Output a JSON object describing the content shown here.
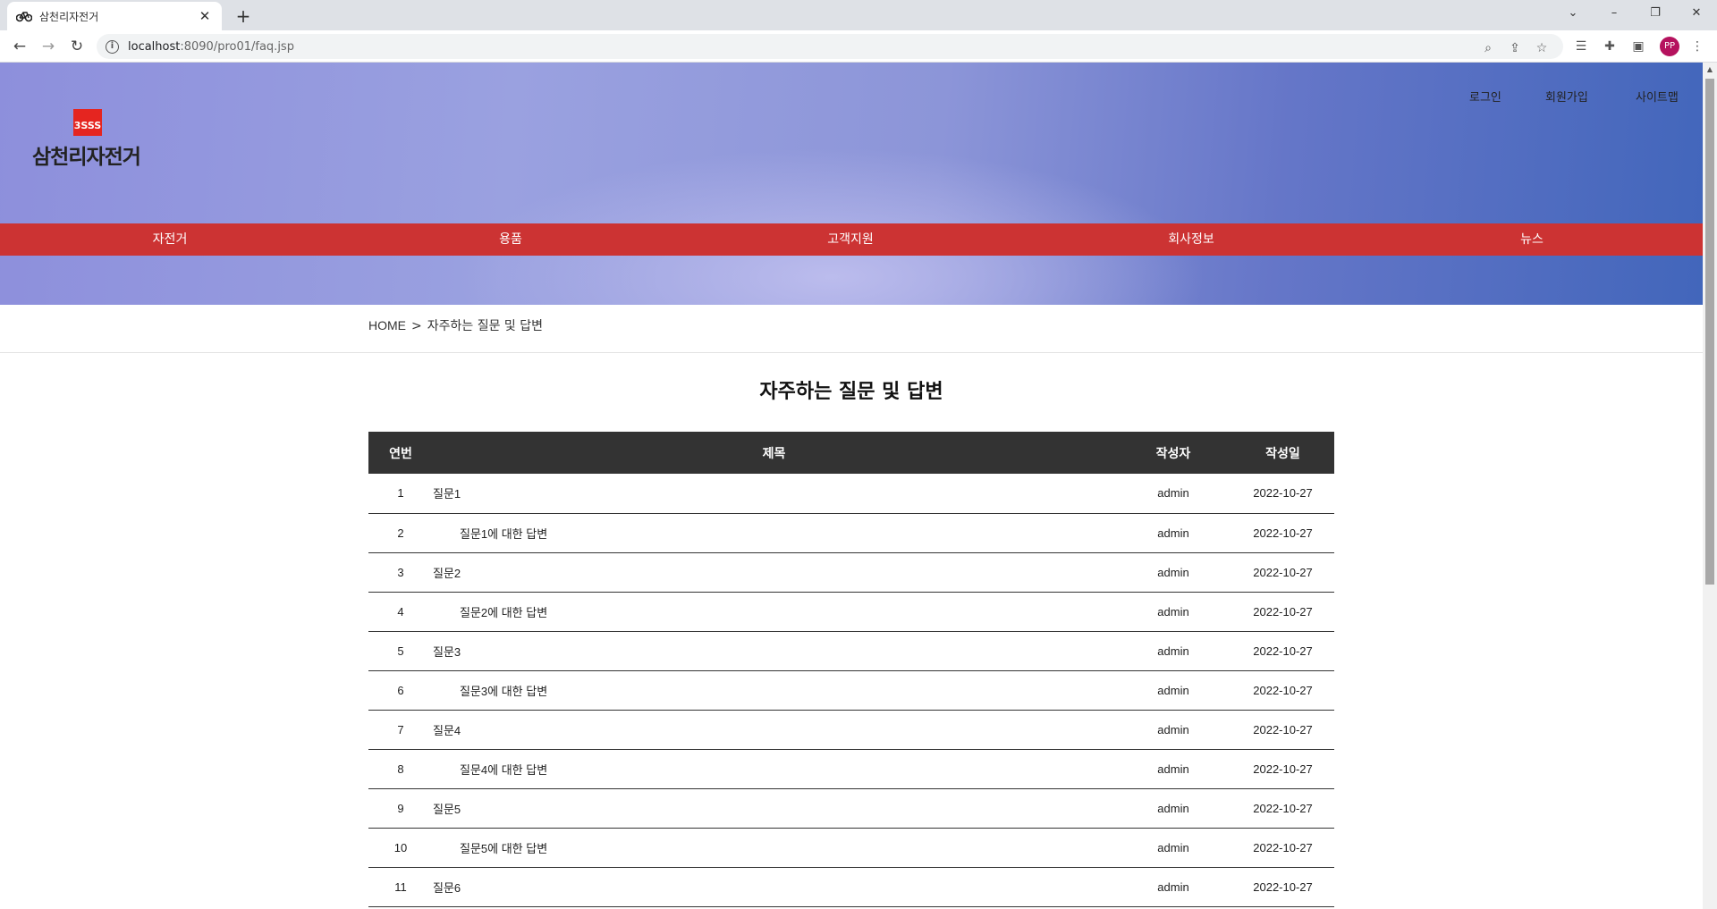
{
  "browser": {
    "tab_title": "삼천리자전거",
    "tab_close": "✕",
    "new_tab": "+",
    "url_host": "localhost",
    "url_path": ":8090/pro01/faq.jsp",
    "profile_initials": "PP",
    "window_controls": {
      "dropdown": "⌄",
      "minimize": "–",
      "restore": "❐",
      "close": "✕"
    }
  },
  "header": {
    "logo_mark": "3SSS",
    "logo_text": "삼천리자전거",
    "top_links": [
      "로그인",
      "회원가입",
      "사이트맵"
    ],
    "nav": [
      "자전거",
      "용품",
      "고객지원",
      "회사정보",
      "뉴스"
    ]
  },
  "breadcrumb": {
    "home": "HOME",
    "separator": ">",
    "current": "자주하는 질문 및 답변"
  },
  "page_title": "자주하는 질문 및 답변",
  "table": {
    "headers": {
      "no": "연번",
      "title": "제목",
      "author": "작성자",
      "date": "작성일"
    },
    "rows": [
      {
        "no": "1",
        "title": "질문1",
        "author": "admin",
        "date": "2022-10-27",
        "answer": false
      },
      {
        "no": "2",
        "title": "질문1에 대한 답변",
        "author": "admin",
        "date": "2022-10-27",
        "answer": true
      },
      {
        "no": "3",
        "title": "질문2",
        "author": "admin",
        "date": "2022-10-27",
        "answer": false
      },
      {
        "no": "4",
        "title": "질문2에 대한 답변",
        "author": "admin",
        "date": "2022-10-27",
        "answer": true
      },
      {
        "no": "5",
        "title": "질문3",
        "author": "admin",
        "date": "2022-10-27",
        "answer": false
      },
      {
        "no": "6",
        "title": "질문3에 대한 답변",
        "author": "admin",
        "date": "2022-10-27",
        "answer": true
      },
      {
        "no": "7",
        "title": "질문4",
        "author": "admin",
        "date": "2022-10-27",
        "answer": false
      },
      {
        "no": "8",
        "title": "질문4에 대한 답변",
        "author": "admin",
        "date": "2022-10-27",
        "answer": true
      },
      {
        "no": "9",
        "title": "질문5",
        "author": "admin",
        "date": "2022-10-27",
        "answer": false
      },
      {
        "no": "10",
        "title": "질문5에 대한 답변",
        "author": "admin",
        "date": "2022-10-27",
        "answer": true
      },
      {
        "no": "11",
        "title": "질문6",
        "author": "admin",
        "date": "2022-10-27",
        "answer": false
      }
    ]
  },
  "colors": {
    "nav_bg": "#cc3333",
    "table_header_bg": "#333333",
    "logo_red": "#e52520",
    "profile_bg": "#b5125e"
  }
}
